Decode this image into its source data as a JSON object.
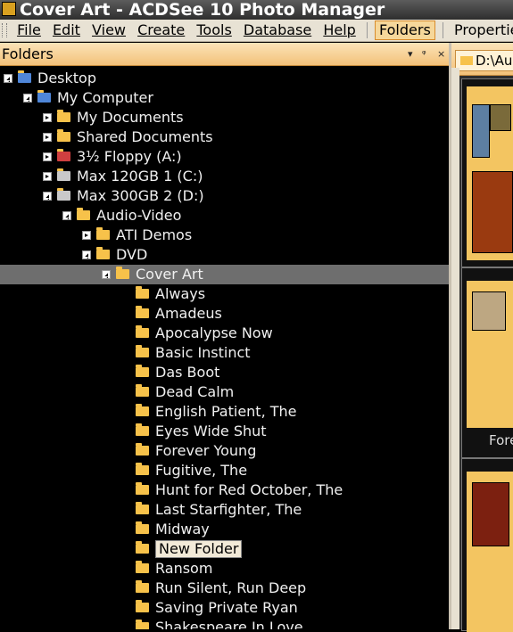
{
  "window": {
    "title": "Cover Art - ACDSee 10 Photo Manager"
  },
  "menu": {
    "items": [
      "File",
      "Edit",
      "View",
      "Create",
      "Tools",
      "Database",
      "Help"
    ],
    "tabs": [
      {
        "label": "Folders",
        "active": true
      },
      {
        "label": "Properties",
        "active": false
      }
    ]
  },
  "panel": {
    "title": "Folders",
    "controls": [
      "▾",
      "ᵠ",
      "×"
    ]
  },
  "tree": {
    "nodes": [
      {
        "label": "Desktop",
        "level": 0,
        "icon": "desktop-icon",
        "expanded": true
      },
      {
        "label": "My Computer",
        "level": 1,
        "icon": "computer-icon",
        "expanded": true
      },
      {
        "label": "My Documents",
        "level": 2,
        "icon": "folder-icon",
        "expanded": false
      },
      {
        "label": "Shared Documents",
        "level": 2,
        "icon": "folder-icon",
        "expanded": false
      },
      {
        "label": "3½ Floppy (A:)",
        "level": 2,
        "icon": "floppy-icon",
        "expanded": false
      },
      {
        "label": "Max 120GB 1 (C:)",
        "level": 2,
        "icon": "drive-icon",
        "expanded": false
      },
      {
        "label": "Max 300GB 2 (D:)",
        "level": 2,
        "icon": "drive-icon",
        "expanded": true
      },
      {
        "label": "Audio-Video",
        "level": 3,
        "icon": "folder-icon",
        "expanded": true
      },
      {
        "label": "ATI Demos",
        "level": 4,
        "icon": "folder-icon",
        "expanded": false
      },
      {
        "label": "DVD",
        "level": 4,
        "icon": "folder-icon",
        "expanded": true
      },
      {
        "label": "Cover Art",
        "level": 5,
        "icon": "folder-open-icon",
        "expanded": true,
        "selected": true
      },
      {
        "label": "Always",
        "level": 6,
        "icon": "folder-icon"
      },
      {
        "label": "Amadeus",
        "level": 6,
        "icon": "folder-icon"
      },
      {
        "label": "Apocalypse Now",
        "level": 6,
        "icon": "folder-icon"
      },
      {
        "label": "Basic Instinct",
        "level": 6,
        "icon": "folder-icon"
      },
      {
        "label": "Das Boot",
        "level": 6,
        "icon": "folder-icon"
      },
      {
        "label": "Dead Calm",
        "level": 6,
        "icon": "folder-icon"
      },
      {
        "label": "English Patient, The",
        "level": 6,
        "icon": "folder-icon"
      },
      {
        "label": "Eyes Wide Shut",
        "level": 6,
        "icon": "folder-icon"
      },
      {
        "label": "Forever Young",
        "level": 6,
        "icon": "folder-icon"
      },
      {
        "label": "Fugitive, The",
        "level": 6,
        "icon": "folder-icon"
      },
      {
        "label": "Hunt for Red October, The",
        "level": 6,
        "icon": "folder-icon"
      },
      {
        "label": "Last Starfighter, The",
        "level": 6,
        "icon": "folder-icon"
      },
      {
        "label": "Midway",
        "level": 6,
        "icon": "folder-icon"
      },
      {
        "label": "New Folder",
        "level": 6,
        "icon": "folder-icon",
        "renaming": true
      },
      {
        "label": "Ransom",
        "level": 6,
        "icon": "folder-icon"
      },
      {
        "label": "Run Silent, Run Deep",
        "level": 6,
        "icon": "folder-icon"
      },
      {
        "label": "Saving Private Ryan",
        "level": 6,
        "icon": "folder-icon"
      },
      {
        "label": "Shakespeare In Love",
        "level": 6,
        "icon": "folder-icon"
      }
    ]
  },
  "right": {
    "path_tab": "D:\\Au",
    "thumbs": [
      {
        "caption": ""
      },
      {
        "caption": "Fore"
      },
      {
        "caption": ""
      }
    ]
  },
  "colors": {
    "accent": "#f3c27a",
    "selection": "#6e6e6e",
    "folder": "#f7c24a"
  }
}
